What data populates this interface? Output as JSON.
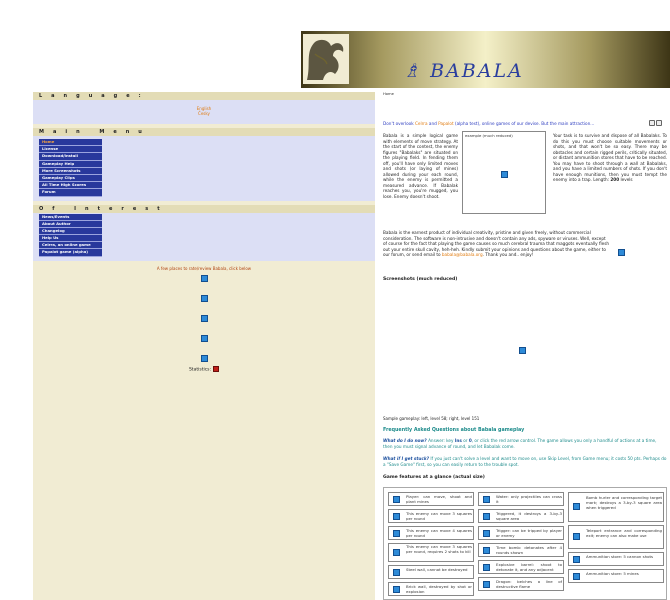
{
  "banner": {
    "logo_text": "♗ BABALA"
  },
  "sidebar": {
    "language_heading": "Language:",
    "languages": [
      "English",
      "Česky"
    ],
    "main_menu_heading": "Main Menu",
    "main_menu": [
      "Home",
      "License",
      "Download/Install",
      "Gameplay Help",
      "More Screenshots",
      "Gameplay Clips",
      "All Time High Scores",
      "Forum"
    ],
    "interest_heading": "Of Interest",
    "interest_menu": [
      "News/Events",
      "About Author",
      "Changelog",
      "Help Us",
      "Celrra, an online game",
      "Papalot game (alpha)"
    ],
    "rate_text": "A few places to rate/review Babala, click below",
    "stats_label": "Statistics:"
  },
  "main": {
    "breadcrumb": "Home",
    "promo_prefix": "Don't overlook ",
    "promo_link1": "Celrra",
    "promo_mid1": " and ",
    "promo_link2": "Papalot",
    "promo_mid2": " (alpha test), online games of our devise. But the main attraction...",
    "intro_left": "Babala is a simple logical game with elements of move strategy. At the start of the contest, the enemy figures \"Babalaks\" are situated on the playing field. In fending them off, you'll have only limited moves and shots (or laying of mines) allowed during your each round, while the enemy is permitted a measured advance. If Babalak reaches you, you're mugged, you lose. Enemy doesn't shoot.",
    "figure_caption": "example (much reduced)",
    "intro_right_prefix": "Your task is to survive and dispose of all Babalaks. To do this you must choose suitable movements or shots, and that won't be so easy. There may be obstacles and certain rigged perils, critically situated, or distant ammunition stores that have to be reached. You may have to shoot through a wall at Babalaks, and you have a limited numbers of shots. If you don't have enough munitions, then you must tempt the enemy into a trap. Length: ",
    "intro_right_length": "200",
    "intro_right_suffix": " levels",
    "description": "Babala is the earnest product of individual creativity, pristine and given freely, without commercial consideration. The software is non-intrusive and doesn't contain any ads, spyware or viruses. Well, except of course for the fact that playing the game causes so much cerebral trauma that maggots eventually flesh out your entire skull cavity, heh-heh. Kindly submit your opinions and questions about the game, either to our forum, or send email to ",
    "email": "babala@babala.org",
    "description_end": ". Thank you and.. enjoy!",
    "screenshots_heading": "Screenshots (much reduced)",
    "screenshots_caption": "Sample gameplay: left, level 58; right, level 151",
    "faq_title": "Frequently Asked Questions about Babala gameplay",
    "faq1_q": "What do I do now?",
    "faq1_a_prefix": " Answer: key ",
    "faq1_key1": "Ins",
    "faq1_or": " or ",
    "faq1_key2": "0",
    "faq1_a_rest": ", or click the red arrow control. The game allows you only a handful of actions at a time, then you must signal advance of round, and let Babalak come.",
    "faq2_q": "What if I get stuck?",
    "faq2_a": " If you just can't solve a level and want to move on, use Skip Level, from Game menu; it costs 50 pts. Perhaps do a \"Save Game\" first, so you can easily return to the trouble spot.",
    "features_heading": "Game features at a glance (actual size)",
    "features_col1": [
      "Player: can move, shoot and plant mines",
      "This enemy can move 3 squares per round",
      "This enemy can move 4 squares per round",
      "This enemy can move 3 squares per round, requires 2 shots to kill",
      "Steel wall, cannot be destroyed",
      "Brick wall, destroyed by shot or explosion"
    ],
    "features_col2": [
      "Water: only projectiles can cross it",
      "Triggered, it destroys a 3-by-3 square area",
      "Trigger: can be tripped by player or enemy",
      "Time bomb: detonates after 4 rounds shown",
      "Explosive barrel: shoot to detonate it, and any adjacent",
      "Dragon: belches a line of destructive flame"
    ],
    "features_col3": [
      "Bomb hurler and corresponding target mark; destroys a 3-by-3 square area when triggered",
      "Teleport entrance and corresponding exit; enemy can also make use",
      "Ammunition store: 5 cannon shots",
      "Ammunition store: 5 mines"
    ]
  },
  "colors": {
    "menu_bg": "#28389c",
    "panel_bg": "#f1ecd3",
    "lang_bg": "#dcdff5",
    "accent_orange": "#e07b10",
    "faq_teal": "#1d8b8b"
  }
}
